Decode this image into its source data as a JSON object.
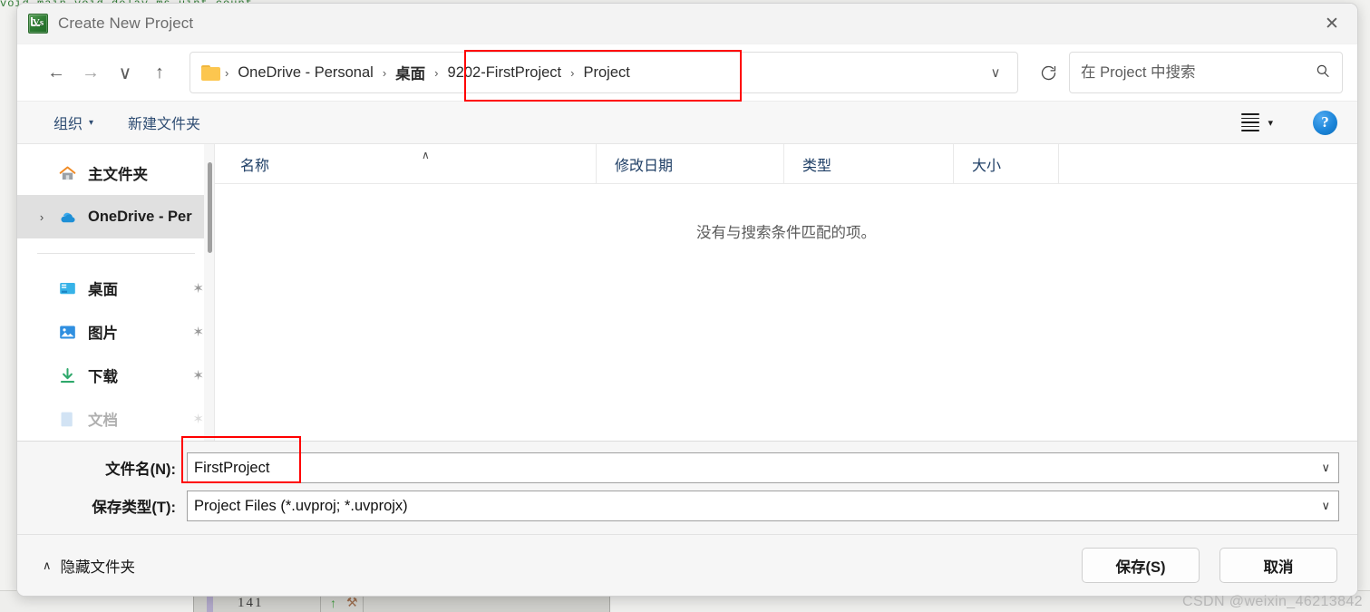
{
  "window": {
    "title": "Create New Project",
    "app_icon": "keil-uvision-icon",
    "close_label": "✕"
  },
  "nav": {
    "back": "←",
    "forward": "→",
    "recent": "∨",
    "up": "↑",
    "folder_icon": "folder-icon",
    "breadcrumbs": [
      {
        "label": "OneDrive - Personal",
        "bold": false
      },
      {
        "label": "桌面",
        "bold": true
      },
      {
        "label": "9202-FirstProject",
        "bold": false
      },
      {
        "label": "Project",
        "bold": false
      }
    ],
    "separator": "›",
    "dropdown": "∨",
    "refresh": "⟳"
  },
  "search": {
    "placeholder": "在 Project 中搜索",
    "value": "",
    "icon": "search-icon"
  },
  "toolbar": {
    "organize": "组织",
    "organize_caret": "▾",
    "new_folder": "新建文件夹",
    "view_caret": "▾",
    "help": "?"
  },
  "sidebar": {
    "items": [
      {
        "label": "主文件夹",
        "icon": "home-icon",
        "expand": "",
        "pin": "",
        "selected": false
      },
      {
        "label": "OneDrive - Per",
        "icon": "onedrive-cloud-icon",
        "expand": "›",
        "pin": "",
        "selected": true
      },
      {
        "label": "桌面",
        "icon": "desktop-icon",
        "expand": "",
        "pin": "✶",
        "selected": false
      },
      {
        "label": "图片",
        "icon": "pictures-icon",
        "expand": "",
        "pin": "✶",
        "selected": false
      },
      {
        "label": "下载",
        "icon": "downloads-icon",
        "expand": "",
        "pin": "✶",
        "selected": false
      },
      {
        "label": "文档",
        "icon": "documents-icon",
        "expand": "",
        "pin": "✶",
        "selected": false
      }
    ]
  },
  "filelist": {
    "columns": [
      {
        "label": "名称"
      },
      {
        "label": "修改日期"
      },
      {
        "label": "类型"
      },
      {
        "label": "大小"
      }
    ],
    "sort_caret": "∧",
    "empty_message": "没有与搜索条件匹配的项。"
  },
  "form": {
    "filename_label": "文件名(N):",
    "filename_value": "FirstProject",
    "filetype_label": "保存类型(T):",
    "filetype_value": "Project Files (*.uvproj; *.uvprojx)",
    "caret": "∨"
  },
  "footer": {
    "hide_folders_caret": "∧",
    "hide_folders": "隐藏文件夹",
    "save": "保存(S)",
    "cancel": "取消"
  },
  "background": {
    "code_strip": "void main  void   delay  ms    uint   count",
    "line_number": "141"
  },
  "watermark": "CSDN @weixin_46213842",
  "colors": {
    "accent_blue": "#2f4d73",
    "annotation_red": "#ff0000",
    "selected_gray": "#e0e0e0",
    "help_blue": "#1b84d8"
  }
}
